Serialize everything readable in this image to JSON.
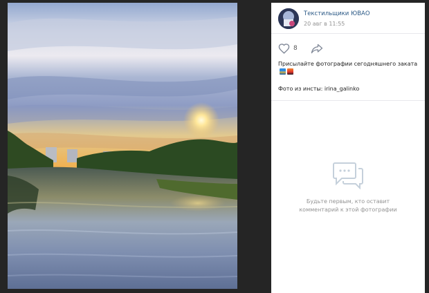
{
  "post": {
    "author_name": "Текстильщики ЮВАО",
    "date": "20 авг в 11:55",
    "likes": "8",
    "caption": "Присылайте фотографии сегодняшнего заката",
    "caption_emojis": [
      "sunset-over-city-emoji",
      "sunset-emoji"
    ],
    "credit": "Фото из инсты: irina_galinko"
  },
  "comments": {
    "empty_line1": "Будьте первым, кто оставит",
    "empty_line2": "комментарий к этой фотографии"
  },
  "colors": {
    "viewer_bg": "#252525",
    "link": "#2a5885",
    "muted": "#939393",
    "icon": "#828a99",
    "empty_icon": "#c5d0db"
  },
  "icons": [
    "heart-outline-icon",
    "share-arrow-icon",
    "comments-bubble-icon"
  ]
}
